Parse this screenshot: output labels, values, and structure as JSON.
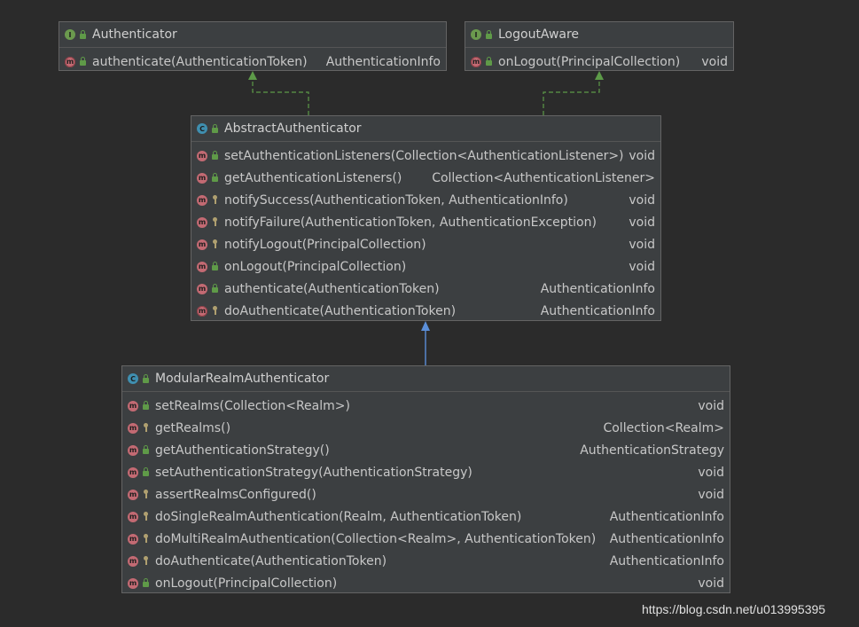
{
  "classes": [
    {
      "key": "authenticator",
      "kind": "I",
      "name": "Authenticator",
      "members": [
        {
          "kind": "m-abstract",
          "visibility": "public",
          "sig": "authenticate(AuthenticationToken)",
          "ret": "AuthenticationInfo"
        }
      ]
    },
    {
      "key": "logoutaware",
      "kind": "I",
      "name": "LogoutAware",
      "members": [
        {
          "kind": "m-abstract",
          "visibility": "public",
          "sig": "onLogout(PrincipalCollection)",
          "ret": "void"
        }
      ]
    },
    {
      "key": "abstract",
      "kind": "C",
      "name": "AbstractAuthenticator",
      "members": [
        {
          "kind": "m",
          "visibility": "public",
          "sig": "setAuthenticationListeners(Collection<AuthenticationListener>)",
          "ret": "void"
        },
        {
          "kind": "m",
          "visibility": "public",
          "sig": "getAuthenticationListeners()",
          "ret": "Collection<AuthenticationListener>"
        },
        {
          "kind": "m",
          "visibility": "protected",
          "sig": "notifySuccess(AuthenticationToken, AuthenticationInfo)",
          "ret": "void"
        },
        {
          "kind": "m",
          "visibility": "protected",
          "sig": "notifyFailure(AuthenticationToken, AuthenticationException)",
          "ret": "void"
        },
        {
          "kind": "m",
          "visibility": "protected",
          "sig": "notifyLogout(PrincipalCollection)",
          "ret": "void"
        },
        {
          "kind": "m",
          "visibility": "public",
          "sig": "onLogout(PrincipalCollection)",
          "ret": "void"
        },
        {
          "kind": "m",
          "visibility": "public",
          "sig": "authenticate(AuthenticationToken)",
          "ret": "AuthenticationInfo"
        },
        {
          "kind": "m-abstract",
          "visibility": "protected",
          "sig": "doAuthenticate(AuthenticationToken)",
          "ret": "AuthenticationInfo"
        }
      ]
    },
    {
      "key": "modular",
      "kind": "C",
      "name": "ModularRealmAuthenticator",
      "members": [
        {
          "kind": "m",
          "visibility": "public",
          "sig": "setRealms(Collection<Realm>)",
          "ret": "void"
        },
        {
          "kind": "m",
          "visibility": "protected",
          "sig": "getRealms()",
          "ret": "Collection<Realm>"
        },
        {
          "kind": "m",
          "visibility": "public",
          "sig": "getAuthenticationStrategy()",
          "ret": "AuthenticationStrategy"
        },
        {
          "kind": "m",
          "visibility": "public",
          "sig": "setAuthenticationStrategy(AuthenticationStrategy)",
          "ret": "void"
        },
        {
          "kind": "m",
          "visibility": "protected",
          "sig": "assertRealmsConfigured()",
          "ret": "void"
        },
        {
          "kind": "m",
          "visibility": "protected",
          "sig": "doSingleRealmAuthentication(Realm, AuthenticationToken)",
          "ret": "AuthenticationInfo"
        },
        {
          "kind": "m",
          "visibility": "protected",
          "sig": "doMultiRealmAuthentication(Collection<Realm>, AuthenticationToken)",
          "ret": "AuthenticationInfo"
        },
        {
          "kind": "m",
          "visibility": "protected",
          "sig": "doAuthenticate(AuthenticationToken)",
          "ret": "AuthenticationInfo"
        },
        {
          "kind": "m",
          "visibility": "public",
          "sig": "onLogout(PrincipalCollection)",
          "ret": "void"
        }
      ]
    }
  ],
  "relations": [
    {
      "from": "abstract",
      "to": "authenticator",
      "type": "implements"
    },
    {
      "from": "abstract",
      "to": "logoutaware",
      "type": "implements"
    },
    {
      "from": "modular",
      "to": "abstract",
      "type": "extends"
    }
  ],
  "colors": {
    "implements": "#5d9a48",
    "extends": "#5b8fd9"
  },
  "watermark": "https://blog.csdn.net/u013995395"
}
